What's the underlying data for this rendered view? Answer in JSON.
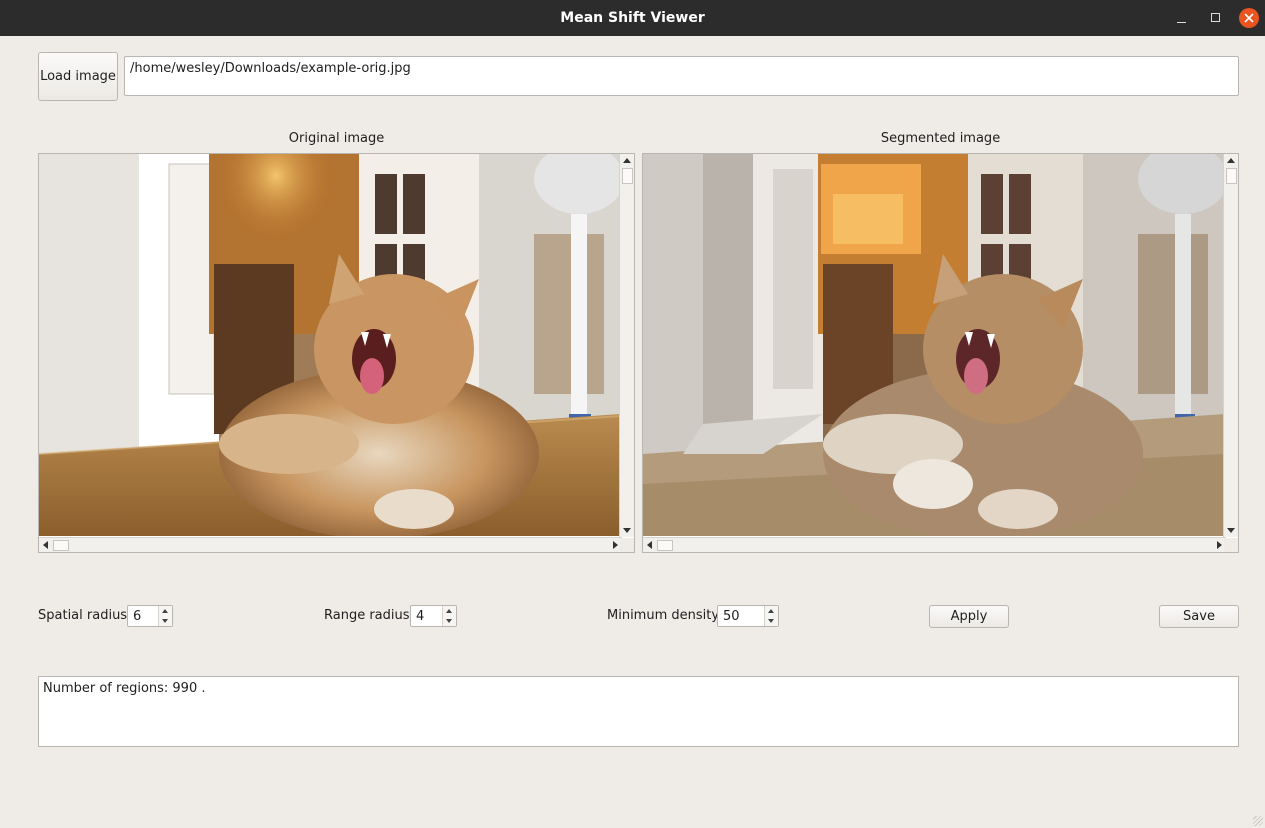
{
  "window": {
    "title": "Mean Shift Viewer"
  },
  "toolbar": {
    "load_label": "Load image",
    "path_value": "/home/wesley/Downloads/example-orig.jpg"
  },
  "panels": {
    "original_caption": "Original image",
    "segmented_caption": "Segmented image"
  },
  "params": {
    "spatial_label": "Spatial radius",
    "spatial_value": "6",
    "range_label": "Range radius",
    "range_value": "4",
    "density_label": "Minimum density",
    "density_value": "50",
    "apply_label": "Apply",
    "save_label": "Save"
  },
  "log": {
    "text": "Number of regions: 990 ."
  },
  "colors": {
    "titlebar": "#2c2c2c",
    "window_bg": "#efebe7",
    "close_button": "#e95420"
  }
}
